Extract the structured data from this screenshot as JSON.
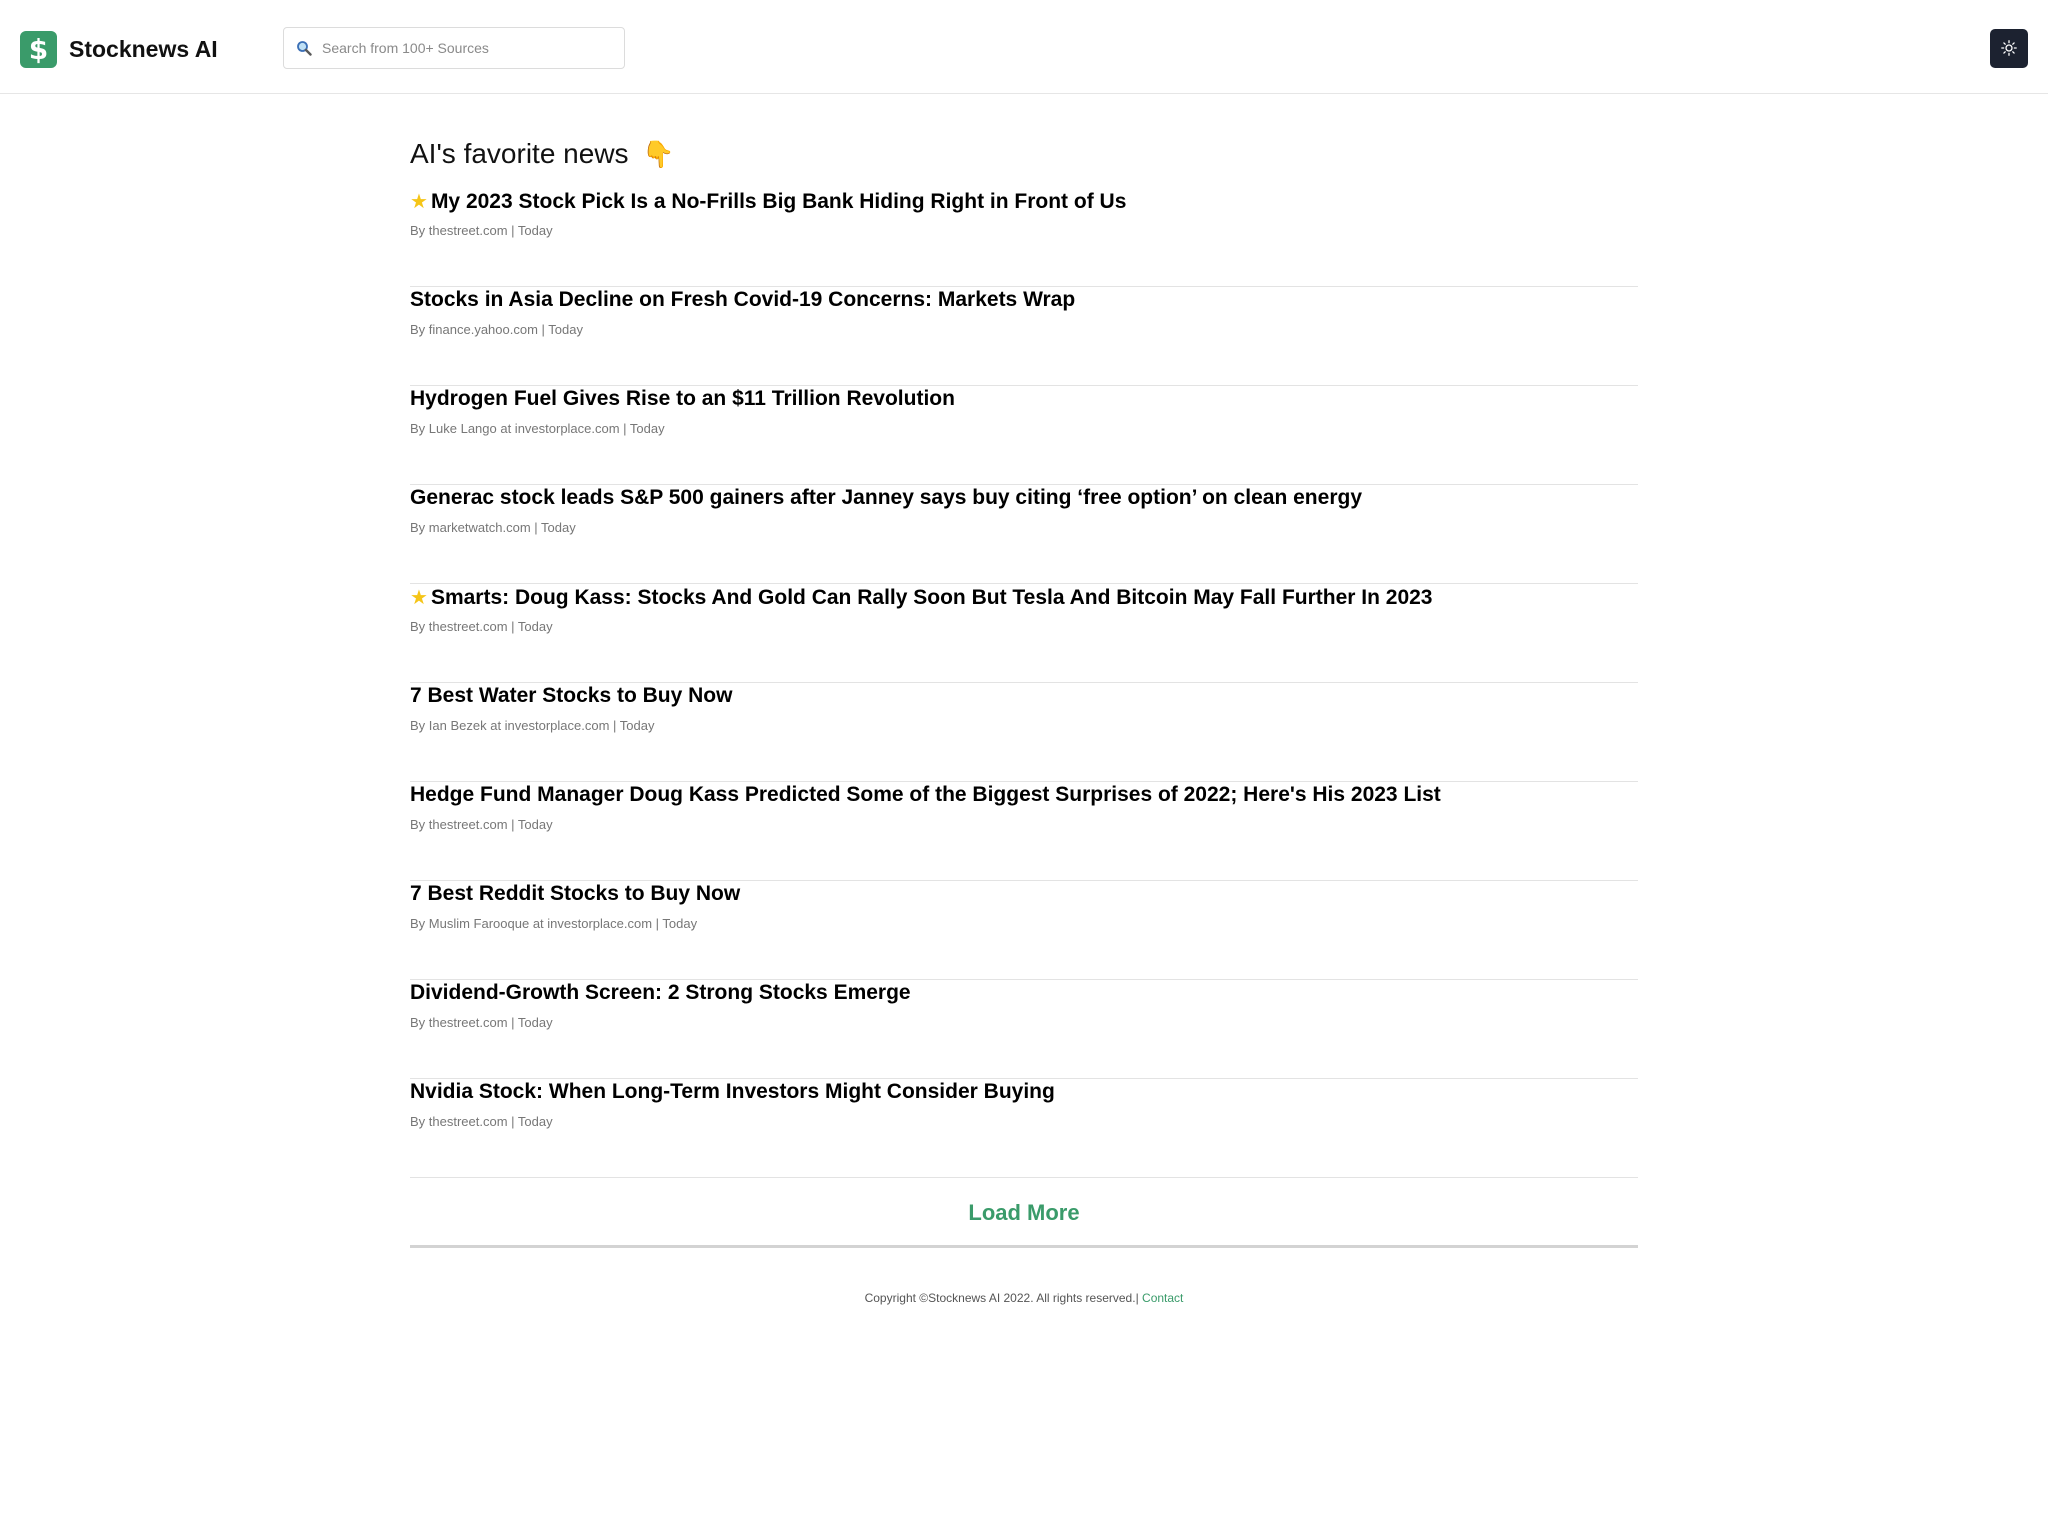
{
  "header": {
    "logo_symbol": "$",
    "brand": "Stocknews AI",
    "search_placeholder": "Search from 100+ Sources",
    "search_icon": "search-icon",
    "theme_icon": "sun-icon",
    "accent_color": "#3a9b6a"
  },
  "section": {
    "title": "AI's favorite news",
    "emoji": "👇"
  },
  "news": [
    {
      "starred": true,
      "star": "★",
      "title": "My 2023 Stock Pick Is a No-Frills Big Bank Hiding Right in Front of Us",
      "meta": "By thestreet.com | Today"
    },
    {
      "starred": false,
      "title": "Stocks in Asia Decline on Fresh Covid-19 Concerns: Markets Wrap",
      "meta": "By finance.yahoo.com | Today"
    },
    {
      "starred": false,
      "title": "Hydrogen Fuel Gives Rise to an $11 Trillion Revolution",
      "meta": "By Luke Lango at investorplace.com | Today"
    },
    {
      "starred": false,
      "title": "Generac stock leads S&P 500 gainers after Janney says buy citing ‘free option’ on clean energy",
      "meta": "By marketwatch.com | Today"
    },
    {
      "starred": true,
      "star": "★",
      "title": "Smarts: Doug Kass: Stocks And Gold Can Rally Soon But Tesla And Bitcoin May Fall Further In 2023",
      "meta": "By thestreet.com | Today"
    },
    {
      "starred": false,
      "title": "7 Best Water Stocks to Buy Now",
      "meta": "By Ian Bezek at investorplace.com | Today"
    },
    {
      "starred": false,
      "title": "Hedge Fund Manager Doug Kass Predicted Some of the Biggest Surprises of 2022; Here's His 2023 List",
      "meta": "By thestreet.com | Today"
    },
    {
      "starred": false,
      "title": "7 Best Reddit Stocks to Buy Now",
      "meta": "By Muslim Farooque at investorplace.com | Today"
    },
    {
      "starred": false,
      "title": "Dividend-Growth Screen: 2 Strong Stocks Emerge",
      "meta": "By thestreet.com | Today"
    },
    {
      "starred": false,
      "title": "Nvidia Stock: When Long-Term Investors Might Consider Buying",
      "meta": "By thestreet.com | Today"
    }
  ],
  "load_more": "Load More",
  "footer": {
    "copyright": "Copyright ©Stocknews AI 2022. All rights reserved.|",
    "contact": "Contact"
  }
}
